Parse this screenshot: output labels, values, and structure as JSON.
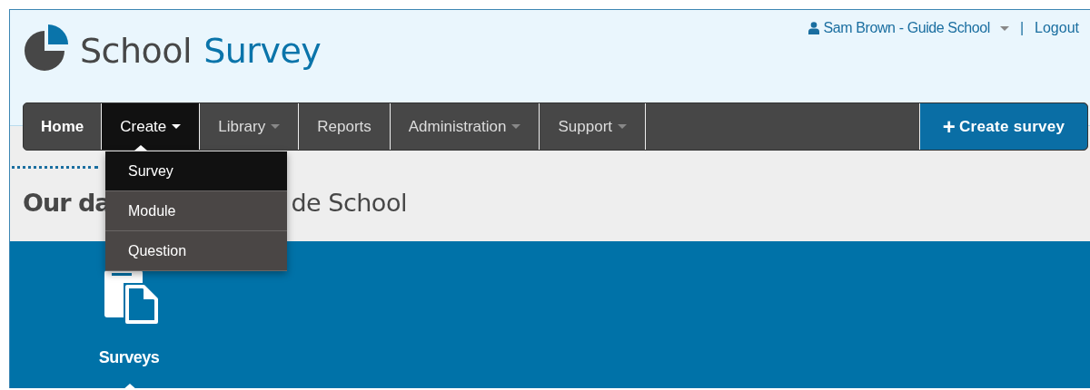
{
  "logo": {
    "word_1": "School",
    "word_2": "Survey"
  },
  "user_menu": {
    "name": "Sam Brown - Guide School",
    "separator": "|",
    "logout": "Logout"
  },
  "nav": [
    {
      "label": "Home",
      "dropdown": false,
      "selected": false,
      "bold": true
    },
    {
      "label": "Create",
      "dropdown": true,
      "selected": true,
      "bold": false
    },
    {
      "label": "Library",
      "dropdown": true,
      "selected": false,
      "bold": false
    },
    {
      "label": "Reports",
      "dropdown": false,
      "selected": false,
      "bold": false
    },
    {
      "label": "Administration",
      "dropdown": true,
      "selected": false,
      "bold": false
    },
    {
      "label": "Support",
      "dropdown": true,
      "selected": false,
      "bold": false
    }
  ],
  "create_button": {
    "icon": "+",
    "label": "Create survey"
  },
  "dropdown": [
    {
      "label": "Survey",
      "selected": true
    },
    {
      "label": "Module",
      "selected": false
    },
    {
      "label": "Question",
      "selected": false
    }
  ],
  "heading_visible_parts": [
    "Our da",
    "de School"
  ],
  "tiles": [
    {
      "label": "Surveys",
      "selected": true
    }
  ]
}
